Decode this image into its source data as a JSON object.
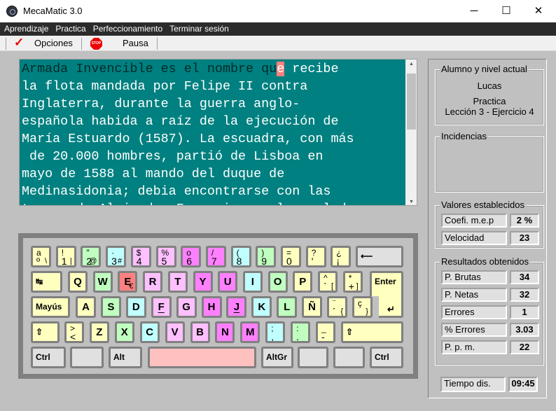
{
  "window": {
    "title": "MecaMatic 3.0",
    "minimize": "─",
    "maximize": "☐",
    "close": "✕"
  },
  "menu": [
    "Aprendizaje",
    "Practica",
    "Perfeccionamiento",
    "Terminar sesión"
  ],
  "toolbar": {
    "options_label": "Opciones",
    "stop_icon_text": "STOP",
    "pause_label": "Pausa"
  },
  "exercise": {
    "typed": "Armada Invencible es el nombre qu",
    "current": "e",
    "rest_first_line": " recibe",
    "lines": [
      "la flota mandada por Felipe II contra",
      "Inglaterra, durante la guerra anglo-",
      "española habida a raíz de la ejecución de",
      "María Estuardo (1587). La escuadra, con más",
      " de 20.000 hombres, partió de Lisboa en",
      "mayo de 1588 al mando del duque de",
      "Medinasidonia; debia encontrarse con las",
      "tropas de Alejandro Farnesio en el canal de"
    ]
  },
  "colors": {
    "yellow": "#ffffc0",
    "green": "#c0ffc0",
    "cyan": "#c0ffff",
    "pink": "#ffc0ff",
    "magenta": "#ff80ff",
    "red": "#ff8080",
    "gray": "#e0e0e0",
    "space": "#ffc0c0"
  },
  "keyboard": [
    [
      {
        "t": "a",
        "b": "º",
        "a": "\\",
        "c": "yellow"
      },
      {
        "t": "!",
        "b": "1",
        "a": "|",
        "c": "yellow"
      },
      {
        "t": "\"",
        "b": "2",
        "a": "@",
        "c": "green"
      },
      {
        "t": "·",
        "b": "3",
        "a": "#",
        "c": "cyan"
      },
      {
        "t": "$",
        "b": "4",
        "c": "pink"
      },
      {
        "t": "%",
        "b": "5",
        "c": "pink"
      },
      {
        "t": "o",
        "b": "6",
        "c": "magenta"
      },
      {
        "t": "/",
        "b": "7",
        "c": "magenta"
      },
      {
        "t": "(",
        "b": "8",
        "c": "cyan"
      },
      {
        "t": ")",
        "b": "9",
        "c": "green"
      },
      {
        "t": "=",
        "b": "0",
        "c": "yellow"
      },
      {
        "t": "?",
        "b": "'",
        "c": "yellow"
      },
      {
        "t": "¿",
        "b": "¡",
        "c": "yellow"
      },
      {
        "l": "⟵",
        "c": "gray",
        "name": "backspace"
      }
    ],
    [
      {
        "l": "↹",
        "c": "yellow",
        "name": "tab"
      },
      {
        "m": "Q",
        "c": "yellow"
      },
      {
        "m": "W",
        "c": "green"
      },
      {
        "m": "E",
        "a": "€",
        "c": "red"
      },
      {
        "m": "R",
        "c": "pink"
      },
      {
        "m": "T",
        "c": "pink"
      },
      {
        "m": "Y",
        "c": "magenta"
      },
      {
        "m": "U",
        "c": "magenta"
      },
      {
        "m": "I",
        "c": "cyan"
      },
      {
        "m": "O",
        "c": "green"
      },
      {
        "m": "P",
        "c": "yellow"
      },
      {
        "t": "^",
        "b": "`",
        "a": "[",
        "c": "yellow"
      },
      {
        "t": "*",
        "b": "+",
        "a": "]",
        "c": "yellow"
      },
      {
        "l": "Enter",
        "c": "yellow",
        "name": "enter"
      }
    ],
    [
      {
        "l": "Mayús",
        "c": "yellow",
        "name": "caps-lock"
      },
      {
        "m": "A",
        "c": "yellow"
      },
      {
        "m": "S",
        "c": "green"
      },
      {
        "m": "D",
        "c": "cyan"
      },
      {
        "m": "F",
        "u": true,
        "c": "pink"
      },
      {
        "m": "G",
        "c": "pink"
      },
      {
        "m": "H",
        "c": "magenta"
      },
      {
        "m": "J",
        "u": true,
        "c": "magenta"
      },
      {
        "m": "K",
        "c": "cyan"
      },
      {
        "m": "L",
        "c": "green"
      },
      {
        "m": "Ñ",
        "c": "yellow"
      },
      {
        "t": "¨",
        "b": "´",
        "a": "{",
        "c": "yellow"
      },
      {
        "t": "ç",
        "a": "}",
        "c": "yellow"
      }
    ],
    [
      {
        "l": "⇧",
        "c": "yellow",
        "name": "left-shift"
      },
      {
        "t": ">",
        "b": "<",
        "c": "yellow"
      },
      {
        "m": "Z",
        "c": "yellow"
      },
      {
        "m": "X",
        "c": "green"
      },
      {
        "m": "C",
        "c": "cyan"
      },
      {
        "m": "V",
        "c": "pink"
      },
      {
        "m": "B",
        "c": "pink"
      },
      {
        "m": "N",
        "c": "magenta"
      },
      {
        "m": "M",
        "c": "magenta"
      },
      {
        "t": ";",
        "b": ",",
        "c": "cyan"
      },
      {
        "t": ":",
        "b": ".",
        "c": "green"
      },
      {
        "t": "_",
        "b": "-",
        "c": "yellow"
      },
      {
        "l": "⇧",
        "c": "yellow",
        "name": "right-shift"
      }
    ],
    [
      {
        "l": "Ctrl",
        "c": "gray",
        "name": "left-ctrl"
      },
      {
        "l": "",
        "c": "gray",
        "name": "win"
      },
      {
        "l": "Alt",
        "c": "gray",
        "name": "alt"
      },
      {
        "l": "",
        "c": "space",
        "name": "space"
      },
      {
        "l": "AltGr",
        "c": "gray",
        "name": "altgr"
      },
      {
        "l": "",
        "c": "gray",
        "name": "win-right"
      },
      {
        "l": "",
        "c": "gray",
        "name": "menu"
      },
      {
        "l": "Ctrl",
        "c": "gray",
        "name": "right-ctrl"
      }
    ]
  ],
  "panel": {
    "student_group": "Alumno y nivel actual",
    "student": "Lucas",
    "mode": "Practica",
    "lesson": "Lección 3 - Ejercicio 4",
    "incidents_group": "Incidencias",
    "settings_group": "Valores establecidos",
    "settings": [
      {
        "label": "Coefi. m.e.p",
        "value": "2 %"
      },
      {
        "label": "Velocidad",
        "value": "23"
      }
    ],
    "results_group": "Resultados obtenidos",
    "results": [
      {
        "label": "P. Brutas",
        "value": "34"
      },
      {
        "label": "P. Netas",
        "value": "32"
      },
      {
        "label": "Errores",
        "value": "1"
      },
      {
        "label": "% Errores",
        "value": "3.03"
      },
      {
        "label": "P. p. m.",
        "value": "22"
      }
    ],
    "time_label": "Tiempo dis.",
    "time_value": "09:45"
  }
}
